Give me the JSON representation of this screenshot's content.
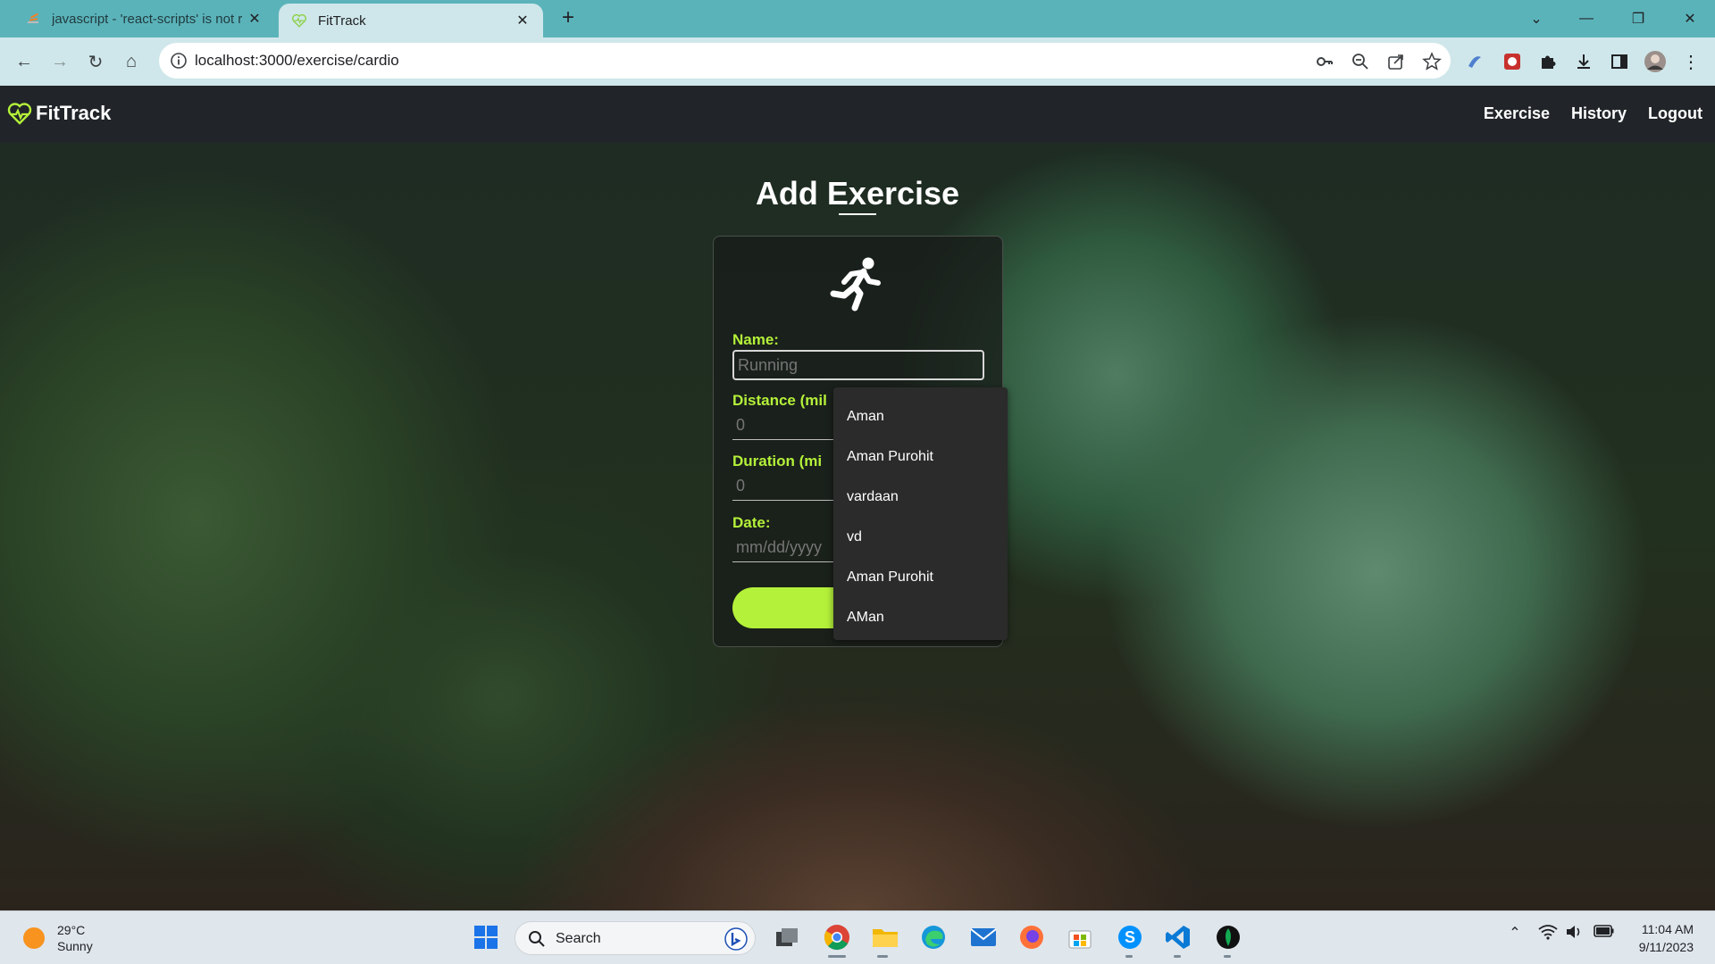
{
  "browser": {
    "tabs": [
      {
        "title": "javascript - 'react-scripts' is not r",
        "active": false
      },
      {
        "title": "FitTrack",
        "active": true
      }
    ],
    "url": "localhost:3000/exercise/cardio"
  },
  "app": {
    "brand": "FitTrack",
    "nav": [
      "Exercise",
      "History",
      "Logout"
    ],
    "accent_color": "#b4f13a"
  },
  "form": {
    "title": "Add Exercise",
    "icon": "running-person-icon",
    "name_label": "Name:",
    "name_placeholder": "Running",
    "distance_label": "Distance (mil",
    "distance_value": "0",
    "duration_label": "Duration (mi",
    "duration_value": "0",
    "date_label": "Date:",
    "date_placeholder": "mm/dd/yyyy"
  },
  "autocomplete": {
    "options": [
      "Aman",
      "Aman Purohit",
      "vardaan",
      "vd",
      "Aman Purohit",
      "AMan"
    ]
  },
  "taskbar": {
    "weather_temp": "29°C",
    "weather_desc": "Sunny",
    "search_label": "Search",
    "time": "11:04 AM",
    "date": "9/11/2023"
  }
}
